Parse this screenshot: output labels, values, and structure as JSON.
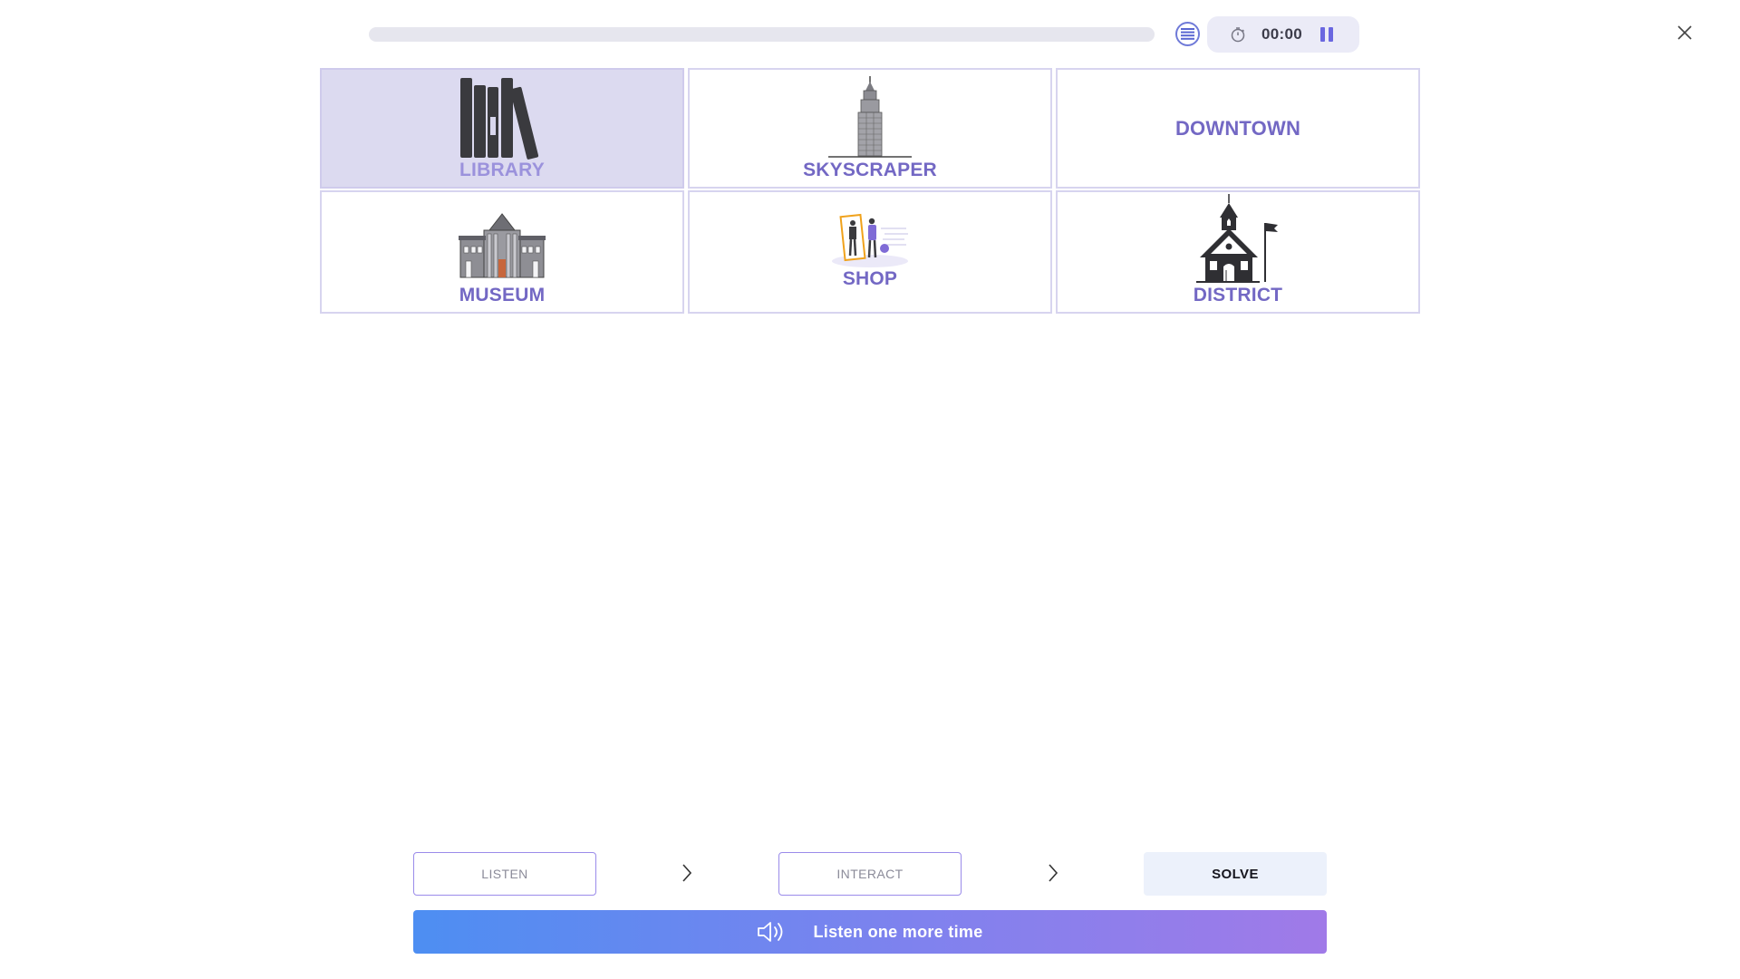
{
  "header": {
    "progress": 0,
    "timer": "00:00",
    "icons": [
      "menu-list-icon",
      "stopwatch-icon",
      "pause-icon",
      "close-icon"
    ]
  },
  "cards": [
    {
      "id": "library",
      "label": "LIBRARY",
      "icon": "books-icon",
      "selected": true
    },
    {
      "id": "skyscraper",
      "label": "SKYSCRAPER",
      "icon": "skyscraper-icon",
      "selected": false
    },
    {
      "id": "downtown",
      "label": "DOWNTOWN",
      "icon": "",
      "selected": false
    },
    {
      "id": "museum",
      "label": "MUSEUM",
      "icon": "museum-building-icon",
      "selected": false
    },
    {
      "id": "shop",
      "label": "SHOP",
      "icon": "shopping-people-icon",
      "selected": false
    },
    {
      "id": "district",
      "label": "DISTRICT",
      "icon": "schoolhouse-icon",
      "selected": false
    }
  ],
  "steps": {
    "listen": "LISTEN",
    "interact": "INTERACT",
    "solve": "SOLVE"
  },
  "listen_again": {
    "label": "Listen one more time",
    "icon": "speaker-icon"
  },
  "colors": {
    "accent": "#7368c4",
    "selected_bg": "#dcdaf0",
    "card_border": "#d7d4ef",
    "gradient_start": "#4d8ef2",
    "gradient_end": "#a07ae8"
  }
}
